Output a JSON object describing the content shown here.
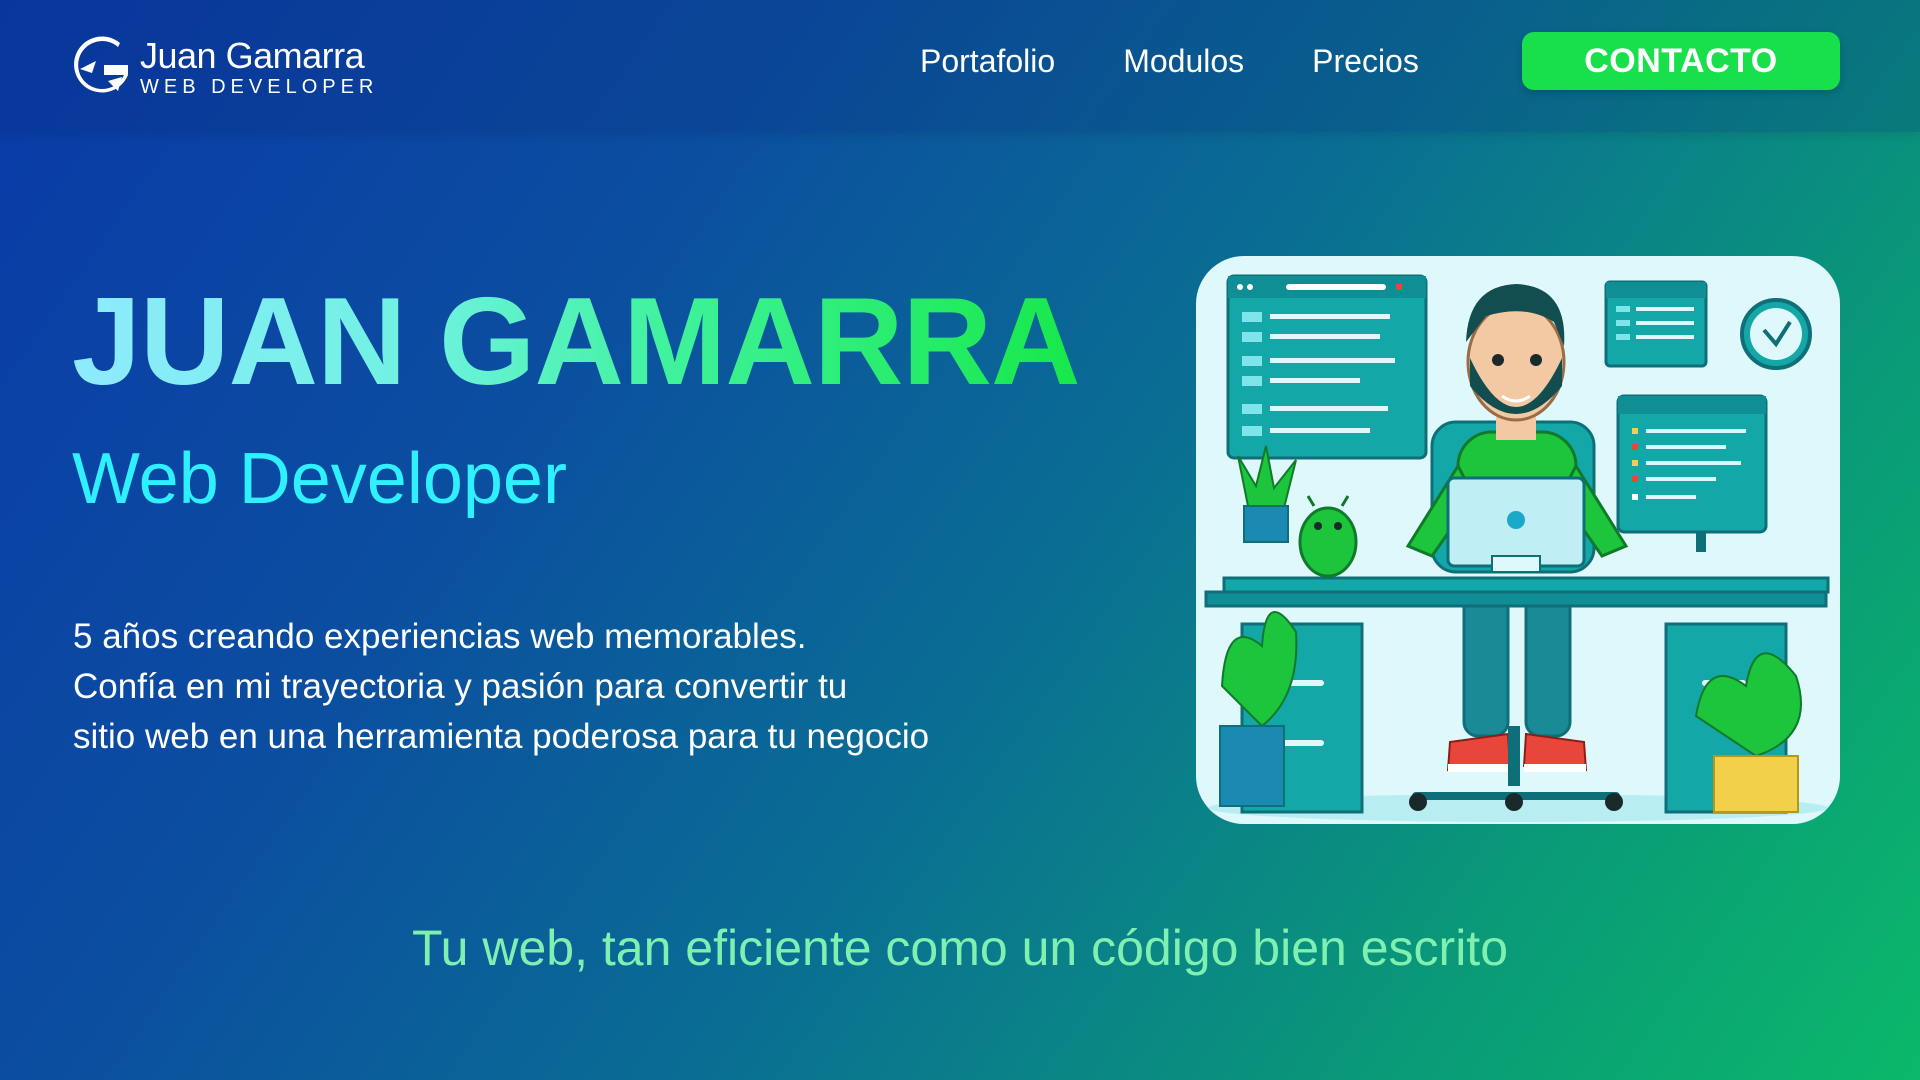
{
  "brand": {
    "name": "Juan Gamarra",
    "tagline": "WEB DEVELOPER",
    "logo_icon": "g-logo-icon"
  },
  "nav": {
    "items": [
      {
        "label": "Portafolio"
      },
      {
        "label": "Modulos"
      },
      {
        "label": "Precios"
      }
    ],
    "cta_label": "CONTACTO"
  },
  "hero": {
    "title": "JUAN GAMARRA",
    "subtitle": "Web Developer",
    "description": [
      "5 años creando experiencias web memorables.",
      "Confía en mi trayectoria y pasión para convertir tu",
      "sitio web en una herramienta poderosa para tu negocio"
    ],
    "illustration": "developer-at-desk-illustration"
  },
  "tagline": "Tu web, tan eficiente como un código bien escrito",
  "colors": {
    "background_start": "#0a3aa8",
    "background_end": "#0bb86a",
    "cta": "#18e04a",
    "subtitle": "#2ff0ff",
    "tagline": "#7ff0b0"
  }
}
